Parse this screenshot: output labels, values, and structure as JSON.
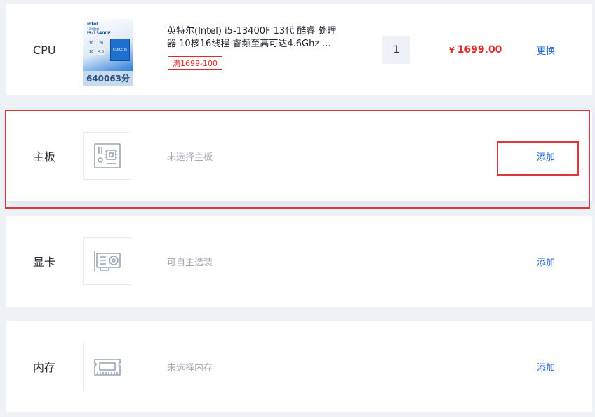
{
  "rows": [
    {
      "category": "CPU",
      "product": {
        "image": {
          "brand": "intel",
          "generation": "13代酷睿",
          "model": "i5-13400F",
          "specs": [
            "10",
            "20",
            "16",
            "4.6"
          ],
          "chip_text": "CORE i5",
          "score": "640063分"
        },
        "title": "英特尔(Intel) i5-13400F 13代 酷睿 处理器 10核16线程 睿频至高可达4.6Ghz ...",
        "promo": "满1699-100",
        "quantity": "1",
        "currency": "¥",
        "price": "1699.00"
      },
      "action": "更换"
    },
    {
      "category": "主板",
      "icon": "motherboard-icon",
      "placeholder": "未选择主板",
      "action": "添加"
    },
    {
      "category": "显卡",
      "icon": "graphics-card-icon",
      "placeholder": "可自主选装",
      "action": "添加"
    },
    {
      "category": "内存",
      "icon": "memory-icon",
      "placeholder": "未选择内存",
      "action": "添加"
    }
  ],
  "colors": {
    "accent_link": "#1f67c7",
    "price": "#e22d2d",
    "highlight": "#e0373c",
    "background": "#eef1f6"
  }
}
